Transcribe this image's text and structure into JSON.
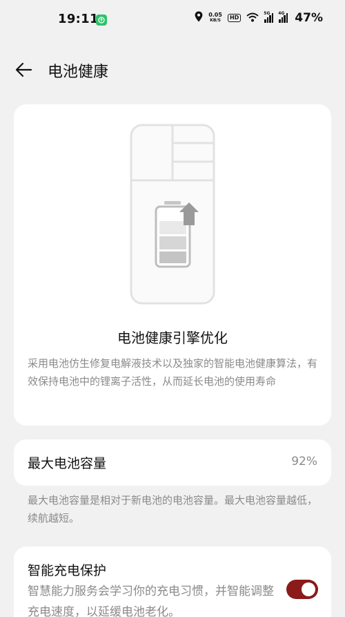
{
  "status_bar": {
    "time": "19:11",
    "net_speed": "0.05",
    "net_unit": "KB/S",
    "hd_label": "HD",
    "sig1_label": "5G",
    "sig2_label": "4G",
    "battery": "47%"
  },
  "header": {
    "title": "电池健康"
  },
  "hero_card": {
    "title": "电池健康引擎优化",
    "description": "采用电池仿生修复电解液技术以及独家的智能电池健康算法，有效保持电池中的锂离子活性，从而延长电池的使用寿命"
  },
  "capacity": {
    "label": "最大电池容量",
    "value": "92%",
    "description": "最大电池容量是相对于新电池的电池容量。最大电池容量越低，续航越短。"
  },
  "smart_charge": {
    "label": "智能充电保护",
    "description": "智慧能力服务会学习你的充电习惯，并智能调整充电速度，以延缓电池老化。",
    "enabled": true
  },
  "colors": {
    "background": "#f1f1f1",
    "card": "#ffffff",
    "accent_toggle": "#8b1a1a",
    "secondary_text": "#8a8a8a"
  },
  "icons": [
    "back-arrow-icon",
    "app-notification-icon",
    "location-icon",
    "wifi-icon",
    "signal-icon",
    "battery-health-icon"
  ]
}
